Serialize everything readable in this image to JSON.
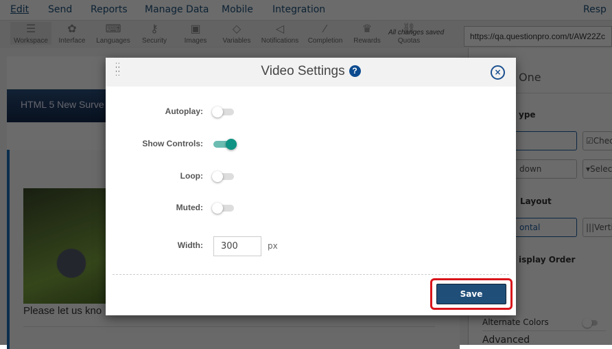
{
  "nav": {
    "items": [
      "Edit",
      "Send",
      "Reports",
      "Manage Data",
      "Mobile",
      "Integration"
    ],
    "right": "Resp"
  },
  "toolbar": {
    "items": [
      {
        "label": "Workspace",
        "icon": "workspace-icon"
      },
      {
        "label": "Interface",
        "icon": "palette-icon"
      },
      {
        "label": "Languages",
        "icon": "keyboard-icon"
      },
      {
        "label": "Security",
        "icon": "key-icon"
      },
      {
        "label": "Images",
        "icon": "image-icon"
      },
      {
        "label": "Variables",
        "icon": "tag-icon"
      },
      {
        "label": "Notifications",
        "icon": "megaphone-icon"
      },
      {
        "label": "Completion",
        "icon": "wand-icon"
      },
      {
        "label": "Rewards",
        "icon": "trophy-icon"
      },
      {
        "label": "Quotas",
        "icon": "link-icon"
      }
    ],
    "status": "All changes saved",
    "url": "https://qa.questionpro.com/t/AW22Zc"
  },
  "survey": {
    "title": "HTML 5 New Surve",
    "question": "Please let us kno"
  },
  "right_panel": {
    "heading": "One",
    "type_label": "ype",
    "type_btn1": "",
    "type_btn2": "Chec",
    "type_btn3": "down",
    "type_btn4": "Selec",
    "layout_label": "Layout",
    "layout_btn1": "ontal",
    "layout_btn2": "Verti",
    "order_label": "isplay Order",
    "alt_colors": "Alternate Colors",
    "advanced": "Advanced"
  },
  "modal": {
    "title": "Video Settings",
    "help": "?",
    "close": "×",
    "settings": [
      {
        "label": "Autoplay:",
        "on": false
      },
      {
        "label": "Show Controls:",
        "on": true
      },
      {
        "label": "Loop:",
        "on": false
      },
      {
        "label": "Muted:",
        "on": false
      }
    ],
    "width_label": "Width:",
    "width_value": "300",
    "width_unit": "px",
    "save": "Save",
    "accent": "#0e9384",
    "highlight": "#d9141b"
  }
}
